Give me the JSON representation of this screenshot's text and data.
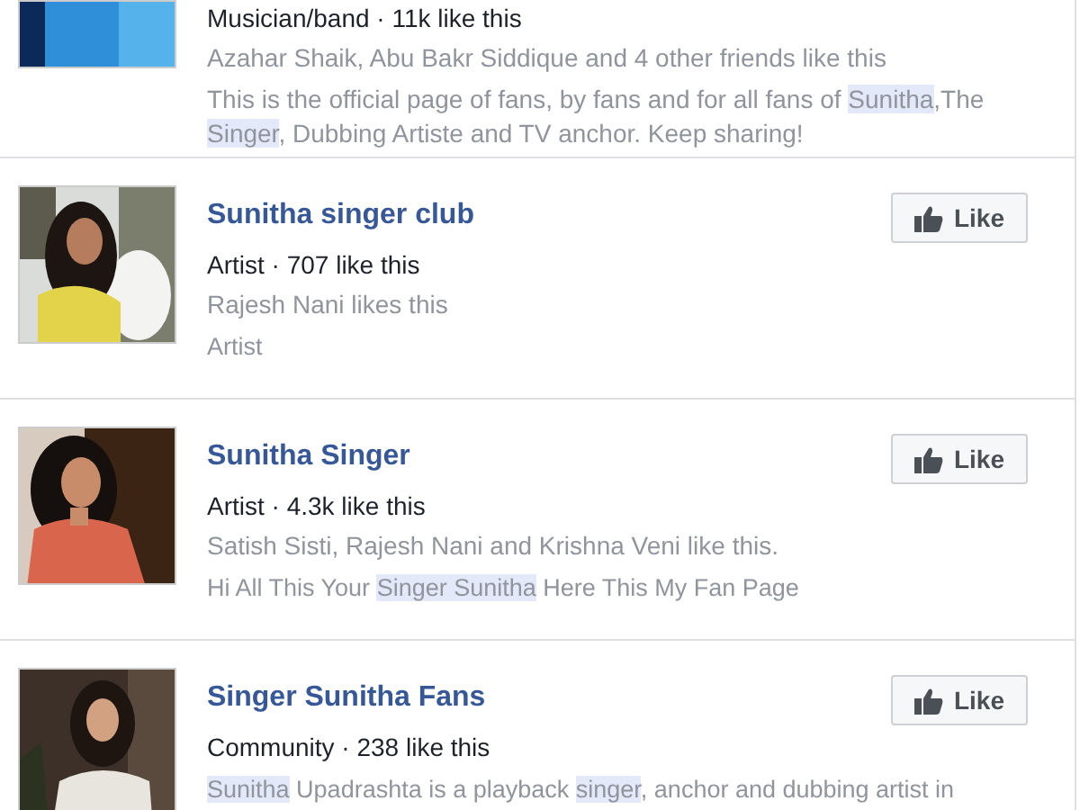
{
  "results": [
    {
      "kind": "partial",
      "meta": "Musician/band · 11k like this",
      "friends": "Azahar Shaik, Abu Bakr Siddique and 4 other friends like this",
      "description": [
        {
          "text": "This is the official page of fans, by fans and for all fans of ",
          "highlighted": false
        },
        {
          "text": "Sunitha",
          "highlighted": true
        },
        {
          "text": ",The ",
          "highlighted": false
        },
        {
          "text": "Singer",
          "highlighted": true
        },
        {
          "text": ", Dubbing Artiste and TV anchor. Keep sharing!",
          "highlighted": false
        }
      ]
    },
    {
      "kind": "full",
      "title": "Sunitha singer club",
      "meta": "Artist · 707 like this",
      "friends": "Rajesh Nani likes this",
      "description": [
        {
          "text": "Artist",
          "highlighted": false
        }
      ],
      "button": "Like"
    },
    {
      "kind": "full",
      "title": "Sunitha Singer",
      "meta": "Artist · 4.3k like this",
      "friends": "Satish Sisti, Rajesh Nani and Krishna Veni like this.",
      "description": [
        {
          "text": "Hi All This Your ",
          "highlighted": false
        },
        {
          "text": "Singer Sunitha",
          "highlighted": true
        },
        {
          "text": " Here This My Fan Page",
          "highlighted": false
        }
      ],
      "button": "Like"
    },
    {
      "kind": "full",
      "title": "Singer Sunitha Fans",
      "meta": "Community · 238 like this",
      "description": [
        {
          "text": "Sunitha",
          "highlighted": true
        },
        {
          "text": " Upadrashta is a playback ",
          "highlighted": false
        },
        {
          "text": "singer",
          "highlighted": true
        },
        {
          "text": ", anchor and dubbing artist in",
          "highlighted": false
        }
      ],
      "button": "Like"
    }
  ]
}
